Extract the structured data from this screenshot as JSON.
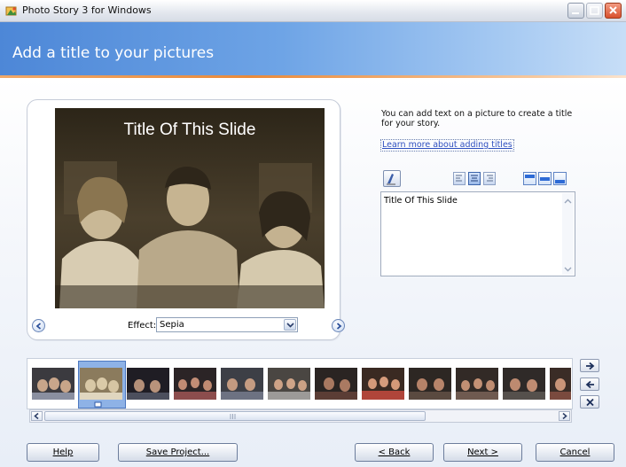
{
  "window": {
    "title": "Photo Story 3 for Windows"
  },
  "header": {
    "heading": "Add a title to your pictures"
  },
  "preview": {
    "slide_title": "Title Of This Slide",
    "effect_label": "Effect:",
    "effect_value": "Sepia"
  },
  "info": {
    "description": "You can add text on a picture to create a title for your story.",
    "learn_more": "Learn more about adding titles"
  },
  "text_editor": {
    "value": "Title Of This Slide"
  },
  "filmstrip": {
    "count": 12,
    "selected_index": 1
  },
  "buttons": {
    "help": "Help",
    "save_project": "Save Project...",
    "back": "< Back",
    "next": "Next >",
    "cancel": "Cancel"
  },
  "colors": {
    "banner": "#4d87d7",
    "accent_line": "#e98a3a",
    "sepia": "#a89a7f"
  }
}
